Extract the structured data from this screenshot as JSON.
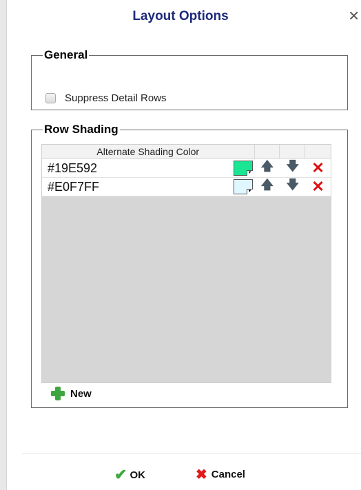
{
  "dialog": {
    "title": "Layout Options",
    "close_symbol": "✕"
  },
  "general": {
    "legend": "General",
    "suppress_detail_rows": {
      "label": "Suppress Detail Rows",
      "checked": false
    }
  },
  "row_shading": {
    "legend": "Row Shading",
    "grid": {
      "header": "Alternate Shading Color",
      "rows": [
        {
          "color": "#19E592"
        },
        {
          "color": "#E0F7FF"
        }
      ]
    },
    "new_button": {
      "label": "New"
    }
  },
  "footer": {
    "ok_label": "OK",
    "cancel_label": "Cancel"
  },
  "icons": {
    "up": "up-arrow-icon",
    "down": "down-arrow-icon",
    "delete": "delete-x-icon",
    "add": "plus-icon",
    "ok": "checkmark-icon",
    "cancel": "x-icon"
  }
}
